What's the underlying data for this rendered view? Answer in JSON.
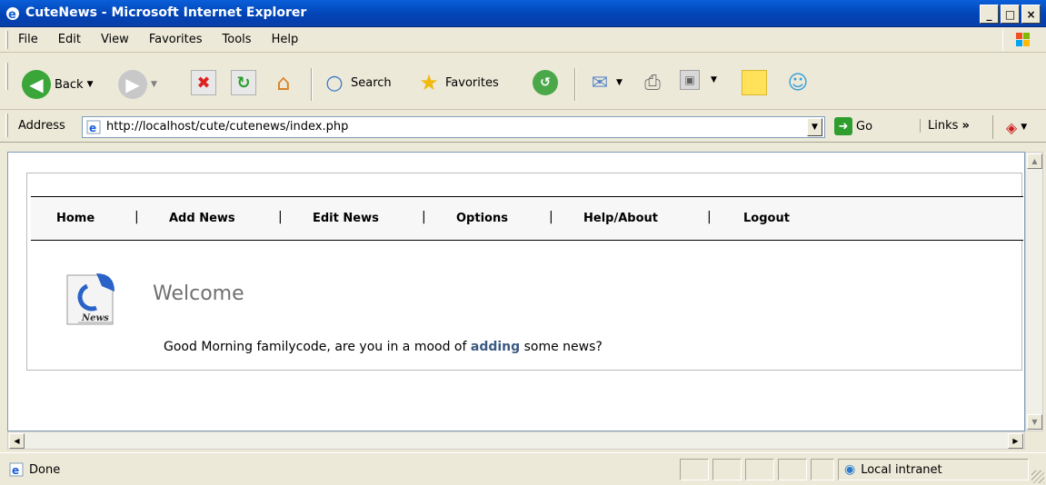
{
  "window": {
    "title": "CuteNews - Microsoft Internet Explorer",
    "minimize": "_",
    "restore": "□",
    "close": "×"
  },
  "menu": {
    "items": [
      {
        "label": "File"
      },
      {
        "label": "Edit"
      },
      {
        "label": "View"
      },
      {
        "label": "Favorites"
      },
      {
        "label": "Tools"
      },
      {
        "label": "Help"
      }
    ]
  },
  "toolbar": {
    "back_label": "Back",
    "search_label": "Search",
    "favorites_label": "Favorites"
  },
  "address": {
    "label": "Address",
    "url": "http://localhost/cute/cutenews/index.php",
    "go_label": "Go",
    "links_label": "Links"
  },
  "page": {
    "nav": [
      {
        "label": "Home"
      },
      {
        "label": "Add News"
      },
      {
        "label": "Edit News"
      },
      {
        "label": "Options"
      },
      {
        "label": "Help/About"
      },
      {
        "label": "Logout"
      }
    ],
    "nav_separator": "|",
    "icon_text": "News",
    "welcome": "Welcome",
    "greeting_before": "Good Morning familycode, are you in a mood of ",
    "greeting_link": "adding",
    "greeting_after": " some news?"
  },
  "status": {
    "text": "Done",
    "zone": "Local intranet"
  }
}
